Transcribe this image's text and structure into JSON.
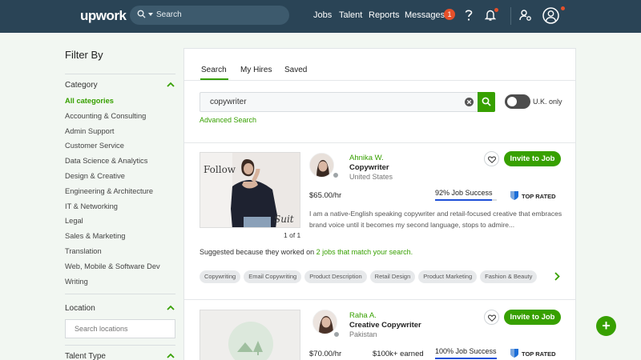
{
  "header": {
    "logo": "upwork",
    "search_label": "Search",
    "nav": [
      "Jobs",
      "Talent",
      "Reports",
      "Messages"
    ],
    "messages_count": "1"
  },
  "sidebar": {
    "title": "Filter By",
    "category": {
      "heading": "Category",
      "items": [
        "All categories",
        "Accounting & Consulting",
        "Admin Support",
        "Customer Service",
        "Data Science & Analytics",
        "Design & Creative",
        "Engineering & Architecture",
        "IT & Networking",
        "Legal",
        "Sales & Marketing",
        "Translation",
        "Web, Mobile & Software Dev",
        "Writing"
      ]
    },
    "location": {
      "heading": "Location",
      "placeholder": "Search locations"
    },
    "talent_type": {
      "heading": "Talent Type"
    }
  },
  "main": {
    "tabs": [
      "Search",
      "My Hires",
      "Saved"
    ],
    "query": "copywriter",
    "toggle_label": "U.K. only",
    "advanced_search": "Advanced Search",
    "results": [
      {
        "name": "Ahnika W.",
        "title": "Copywriter",
        "location": "United States",
        "rate": "$65.00/hr",
        "job_success": "92% Job Success",
        "job_success_pct": 92,
        "badge": "TOP RATED",
        "thumb_text_1": "Follow",
        "thumb_text_2": "Suit",
        "portfolio_counter": "1 of 1",
        "overview": "I am a native-English speaking copywriter and retail-focused creative that embraces brand voice until it becomes my second language, stops to admire...",
        "invite_label": "Invite to Job",
        "suggest_prefix": "Suggested because they worked on ",
        "suggest_link": "2 jobs that match your search.",
        "skills": [
          "Copywriting",
          "Email Copywriting",
          "Product Description",
          "Retail Design",
          "Product Marketing",
          "Fashion & Beauty"
        ]
      },
      {
        "name": "Raha A.",
        "title": "Creative Copywriter",
        "location": "Pakistan",
        "rate": "$70.00/hr",
        "earned": "$100k+ earned",
        "job_success": "100% Job Success",
        "job_success_pct": 100,
        "badge": "TOP RATED",
        "invite_label": "Invite to Job"
      }
    ]
  },
  "colors": {
    "brand_green": "#37a000",
    "header_bg": "#2a4456",
    "notify": "#e5502a"
  }
}
